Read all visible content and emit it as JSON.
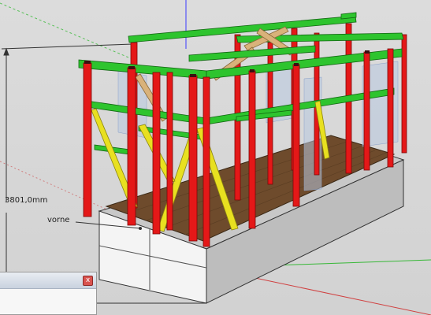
{
  "app": "SketchUp",
  "viewport": {
    "dimension_label": "3801,0mm",
    "callout_label": "vorne"
  },
  "panel": {
    "close_glyph": "x",
    "close_icon": "close-icon"
  },
  "colors": {
    "post_red": "#e41818",
    "beam_green": "#2ec42e",
    "brace_yellow": "#e8e020",
    "brace_tan": "#d9b27a",
    "floor_brown": "#6e4b2c",
    "axis_blue": "#3a3aff",
    "axis_green": "#38b838",
    "axis_red": "#d04040"
  }
}
